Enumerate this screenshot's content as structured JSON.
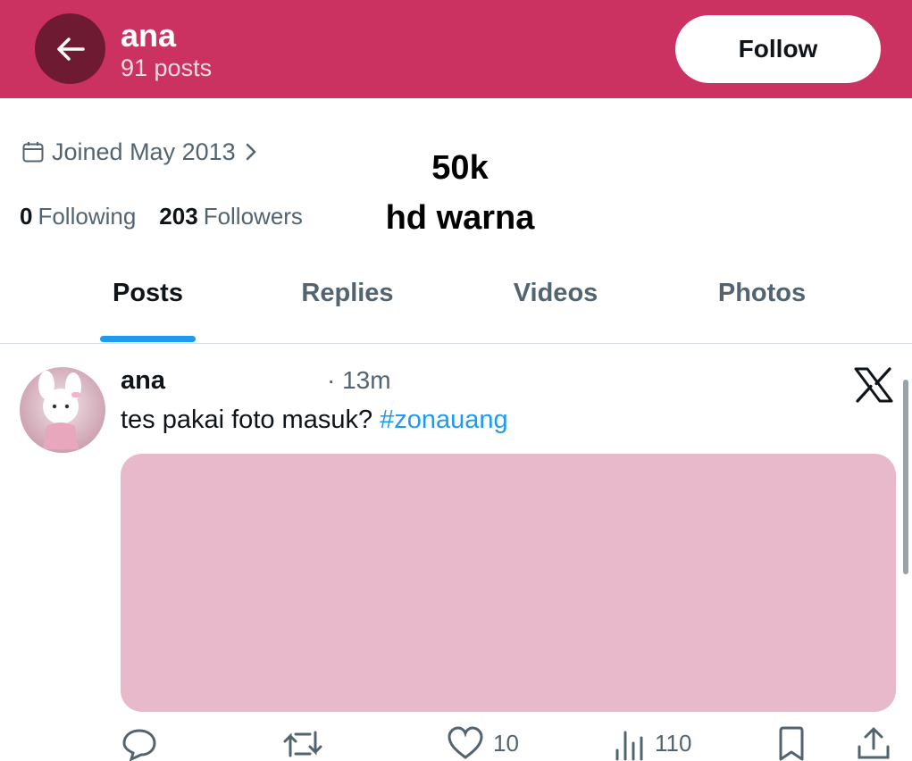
{
  "header": {
    "name": "ana",
    "posts_count": "91 posts",
    "follow_label": "Follow",
    "background": "#cb3262"
  },
  "profile": {
    "joined": "Joined May 2013",
    "following_count": "0",
    "following_label": "Following",
    "followers_count": "203",
    "followers_label": "Followers"
  },
  "overlay": {
    "line1": "50k",
    "line2": "hd warna"
  },
  "tabs": [
    {
      "label": "Posts",
      "active": true
    },
    {
      "label": "Replies",
      "active": false
    },
    {
      "label": "Videos",
      "active": false
    },
    {
      "label": "Photos",
      "active": false
    }
  ],
  "post": {
    "author": "ana",
    "time": "· 13m",
    "text": "tes pakai foto masuk? ",
    "hashtag": "#zonauang",
    "media_color": "#e7b9cb",
    "actions": {
      "reply": "",
      "repost": "",
      "like": "10",
      "views": "110"
    }
  },
  "icons": [
    "back-arrow-icon",
    "calendar-icon",
    "chevron-right-icon",
    "x-logo-icon",
    "reply-icon",
    "repost-icon",
    "like-icon",
    "views-icon",
    "bookmark-icon",
    "share-icon"
  ],
  "colors": {
    "accent": "#1d9bf0",
    "muted": "#536471",
    "text": "#0f1419"
  }
}
